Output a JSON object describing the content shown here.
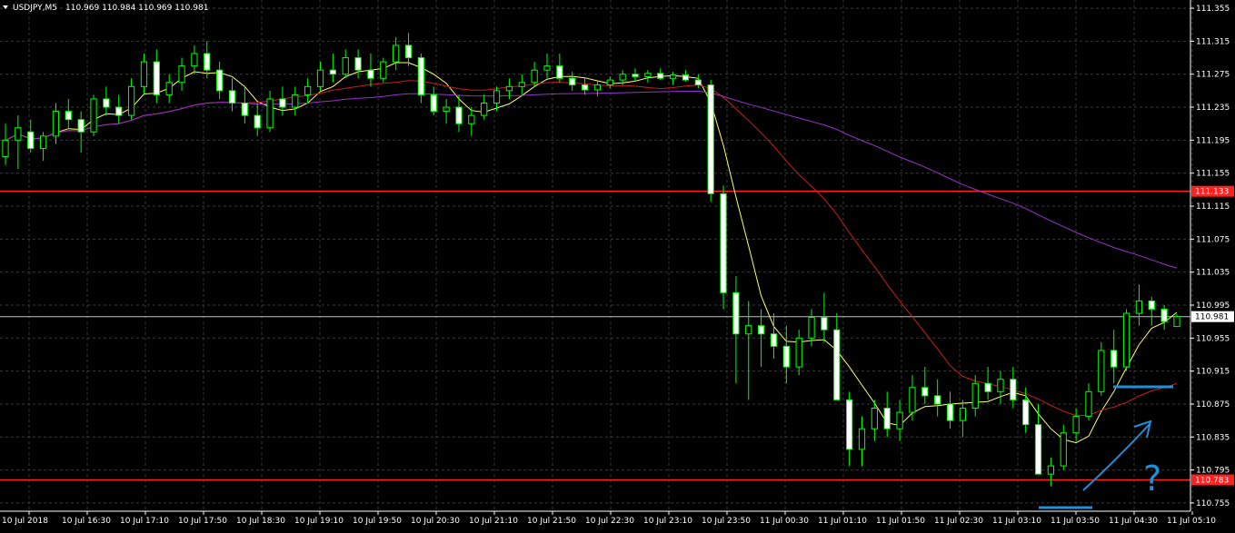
{
  "chart_data": {
    "type": "candlestick",
    "header": {
      "symbol": "USDJPY,M5",
      "ohlc": "110.969 110.984 110.969 110.981"
    },
    "y_ticks": [
      "111.355",
      "111.315",
      "111.275",
      "111.235",
      "111.195",
      "111.155",
      "111.115",
      "111.075",
      "111.035",
      "110.995",
      "110.955",
      "110.915",
      "110.875",
      "110.835",
      "110.795",
      "110.755"
    ],
    "ylim": [
      110.745,
      111.365
    ],
    "x_ticks": [
      "10 Jul 2018",
      "10 Jul 16:30",
      "10 Jul 17:10",
      "10 Jul 17:50",
      "10 Jul 18:30",
      "10 Jul 19:10",
      "10 Jul 19:50",
      "10 Jul 20:30",
      "10 Jul 21:10",
      "10 Jul 21:50",
      "10 Jul 22:30",
      "10 Jul 23:10",
      "10 Jul 23:50",
      "11 Jul 00:30",
      "11 Jul 01:10",
      "11 Jul 01:50",
      "11 Jul 02:30",
      "11 Jul 03:10",
      "11 Jul 03:50",
      "11 Jul 04:30",
      "11 Jul 05:10"
    ],
    "hlines": [
      {
        "value": 111.133,
        "label": "111.133",
        "color": "#ff2020"
      },
      {
        "value": 110.783,
        "label": "110.783",
        "color": "#ff2020"
      },
      {
        "value": 110.981,
        "label": "110.981",
        "color": "#c0c0c0"
      }
    ],
    "candles": [
      [
        111.175,
        111.215,
        111.165,
        111.195
      ],
      [
        111.195,
        111.225,
        111.16,
        111.21
      ],
      [
        111.205,
        111.22,
        111.18,
        111.185
      ],
      [
        111.185,
        111.205,
        111.17,
        111.2
      ],
      [
        111.2,
        111.24,
        111.19,
        111.23
      ],
      [
        111.23,
        111.245,
        111.21,
        111.22
      ],
      [
        111.22,
        111.23,
        111.18,
        111.205
      ],
      [
        111.205,
        111.25,
        111.2,
        111.245
      ],
      [
        111.245,
        111.26,
        111.225,
        111.235
      ],
      [
        111.235,
        111.25,
        111.215,
        111.225
      ],
      [
        111.225,
        111.27,
        111.22,
        111.26
      ],
      [
        111.26,
        111.3,
        111.25,
        111.29
      ],
      [
        111.29,
        111.305,
        111.24,
        111.25
      ],
      [
        111.25,
        111.275,
        111.24,
        111.265
      ],
      [
        111.265,
        111.295,
        111.255,
        111.285
      ],
      [
        111.285,
        111.31,
        111.275,
        111.3
      ],
      [
        111.3,
        111.315,
        111.27,
        111.28
      ],
      [
        111.28,
        111.29,
        111.245,
        111.255
      ],
      [
        111.255,
        111.27,
        111.23,
        111.24
      ],
      [
        111.24,
        111.26,
        111.215,
        111.225
      ],
      [
        111.225,
        111.24,
        111.2,
        111.21
      ],
      [
        111.21,
        111.255,
        111.205,
        111.245
      ],
      [
        111.245,
        111.26,
        111.225,
        111.235
      ],
      [
        111.235,
        111.26,
        111.225,
        111.25
      ],
      [
        111.25,
        111.27,
        111.24,
        111.26
      ],
      [
        111.26,
        111.29,
        111.255,
        111.28
      ],
      [
        111.28,
        111.3,
        111.265,
        111.275
      ],
      [
        111.275,
        111.305,
        111.27,
        111.295
      ],
      [
        111.295,
        111.305,
        111.27,
        111.28
      ],
      [
        111.28,
        111.3,
        111.26,
        111.27
      ],
      [
        111.27,
        111.295,
        111.265,
        111.29
      ],
      [
        111.29,
        111.32,
        111.28,
        111.31
      ],
      [
        111.31,
        111.325,
        111.285,
        111.295
      ],
      [
        111.295,
        111.3,
        111.24,
        111.25
      ],
      [
        111.25,
        111.26,
        111.225,
        111.23
      ],
      [
        111.23,
        111.245,
        111.215,
        111.235
      ],
      [
        111.235,
        111.25,
        111.205,
        111.215
      ],
      [
        111.215,
        111.235,
        111.2,
        111.225
      ],
      [
        111.225,
        111.25,
        111.22,
        111.24
      ],
      [
        111.24,
        111.26,
        111.23,
        111.255
      ],
      [
        111.255,
        111.27,
        111.245,
        111.26
      ],
      [
        111.26,
        111.275,
        111.25,
        111.265
      ],
      [
        111.265,
        111.29,
        111.26,
        111.28
      ],
      [
        111.28,
        111.3,
        111.27,
        111.285
      ],
      [
        111.285,
        111.3,
        111.265,
        111.27
      ],
      [
        111.27,
        111.278,
        111.255,
        111.262
      ],
      [
        111.262,
        111.27,
        111.25,
        111.256
      ],
      [
        111.256,
        111.266,
        111.248,
        111.262
      ],
      [
        111.262,
        111.272,
        111.258,
        111.268
      ],
      [
        111.268,
        111.28,
        111.262,
        111.275
      ],
      [
        111.275,
        111.282,
        111.266,
        111.272
      ],
      [
        111.272,
        111.28,
        111.265,
        111.276
      ],
      [
        111.276,
        111.282,
        111.268,
        111.27
      ],
      [
        111.27,
        111.278,
        111.262,
        111.274
      ],
      [
        111.274,
        111.28,
        111.266,
        111.268
      ],
      [
        111.268,
        111.275,
        111.258,
        111.262
      ],
      [
        111.262,
        111.268,
        111.12,
        111.13
      ],
      [
        111.13,
        111.14,
        110.99,
        111.01
      ],
      [
        111.01,
        111.03,
        110.9,
        110.96
      ],
      [
        110.96,
        111.0,
        110.88,
        110.97
      ],
      [
        110.97,
        110.99,
        110.92,
        110.96
      ],
      [
        110.96,
        110.985,
        110.93,
        110.945
      ],
      [
        110.945,
        110.97,
        110.9,
        110.92
      ],
      [
        110.92,
        110.965,
        110.91,
        110.955
      ],
      [
        110.955,
        110.99,
        110.945,
        110.98
      ],
      [
        110.98,
        111.01,
        110.95,
        110.965
      ],
      [
        110.965,
        110.985,
        110.9,
        110.88
      ],
      [
        110.88,
        110.89,
        110.8,
        110.82
      ],
      [
        110.82,
        110.86,
        110.8,
        110.845
      ],
      [
        110.845,
        110.88,
        110.83,
        110.87
      ],
      [
        110.87,
        110.89,
        110.835,
        110.845
      ],
      [
        110.845,
        110.88,
        110.83,
        110.865
      ],
      [
        110.865,
        110.91,
        110.855,
        110.895
      ],
      [
        110.895,
        110.92,
        110.875,
        110.885
      ],
      [
        110.885,
        110.905,
        110.86,
        110.875
      ],
      [
        110.875,
        110.89,
        110.845,
        110.855
      ],
      [
        110.855,
        110.88,
        110.835,
        110.87
      ],
      [
        110.87,
        110.91,
        110.86,
        110.9
      ],
      [
        110.9,
        110.92,
        110.88,
        110.89
      ],
      [
        110.89,
        110.915,
        110.875,
        110.905
      ],
      [
        110.905,
        110.92,
        110.87,
        110.88
      ],
      [
        110.88,
        110.895,
        110.84,
        110.85
      ],
      [
        110.85,
        110.875,
        110.8,
        110.79
      ],
      [
        110.79,
        110.81,
        110.775,
        110.8
      ],
      [
        110.8,
        110.85,
        110.795,
        110.84
      ],
      [
        110.84,
        110.87,
        110.83,
        110.86
      ],
      [
        110.86,
        110.9,
        110.855,
        110.89
      ],
      [
        110.89,
        110.95,
        110.885,
        110.94
      ],
      [
        110.94,
        110.965,
        110.9,
        110.92
      ],
      [
        110.92,
        110.99,
        110.915,
        110.985
      ],
      [
        110.985,
        111.02,
        110.97,
        111.0
      ],
      [
        111.0,
        111.005,
        110.97,
        110.99
      ],
      [
        110.99,
        110.995,
        110.965,
        110.975
      ],
      [
        110.969,
        110.984,
        110.969,
        110.981
      ]
    ],
    "series": [],
    "grid": true,
    "legend": "none"
  },
  "annotations": {
    "question_mark": "?",
    "arrow_color": "#1f8fd8"
  },
  "colors": {
    "bull": "#00ff00",
    "bull_fill": "#000000",
    "bear_fill": "#ffffff",
    "grid": "#3a3a3a",
    "ma_fast": "#ffff66",
    "ma_mid": "#c81e1e",
    "ma_slow": "#9932cc"
  }
}
